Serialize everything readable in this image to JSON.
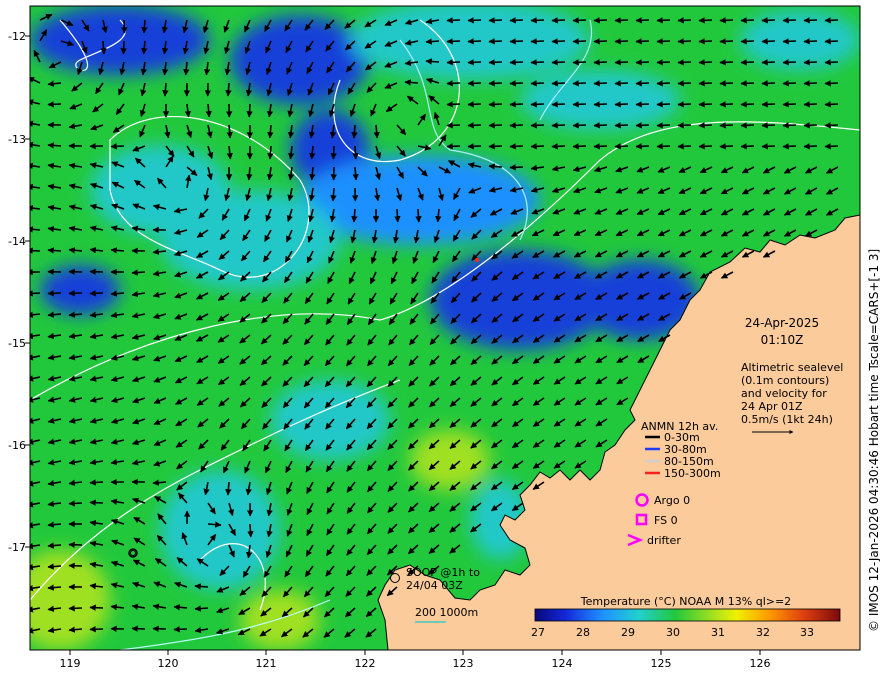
{
  "map": {
    "lon_ticks": [
      "119",
      "120",
      "121",
      "122",
      "123",
      "124",
      "125",
      "126"
    ],
    "lat_ticks": [
      "-12",
      "-13",
      "-14",
      "-15",
      "-16",
      "-17"
    ],
    "date": "24-Apr-2025",
    "time": "01:10Z",
    "altimetry_lines": [
      "Altimetric sealevel",
      "(0.1m contours)",
      "and velocity for",
      "24 Apr 01Z",
      "0.5m/s (1kt 24h)"
    ],
    "anmn": {
      "title": "ANMN 12h av.",
      "items": [
        {
          "label": "0-30m",
          "color": "#000000"
        },
        {
          "label": "30-80m",
          "color": "#1e3cff"
        },
        {
          "label": "80-150m",
          "color": "#d0d0d0"
        },
        {
          "label": "150-300m",
          "color": "#ff2020"
        }
      ]
    },
    "argo_label": "Argo 0",
    "fs_label": "FS 0",
    "drifter_label": "drifter",
    "soop_lines": [
      "SOOP @1h to",
      "24/04 03Z"
    ],
    "depth_label": "200  1000m",
    "colorbar": {
      "title": "Temperature (°C) NOAA  M 13% ql>=2",
      "ticks": [
        "27",
        "28",
        "29",
        "30",
        "31",
        "32",
        "33"
      ]
    },
    "credit": "© IMOS 12-Jan-2026 04:30:46 Hobart time Tscale=CARS+[-1 3]",
    "colors": {
      "land": "#fbcb9b",
      "ocean_green": "#22c83c",
      "ocean_cyan": "#22c8c8",
      "ocean_blue": "#1640d8",
      "marker_magenta": "#ff00ff"
    }
  }
}
